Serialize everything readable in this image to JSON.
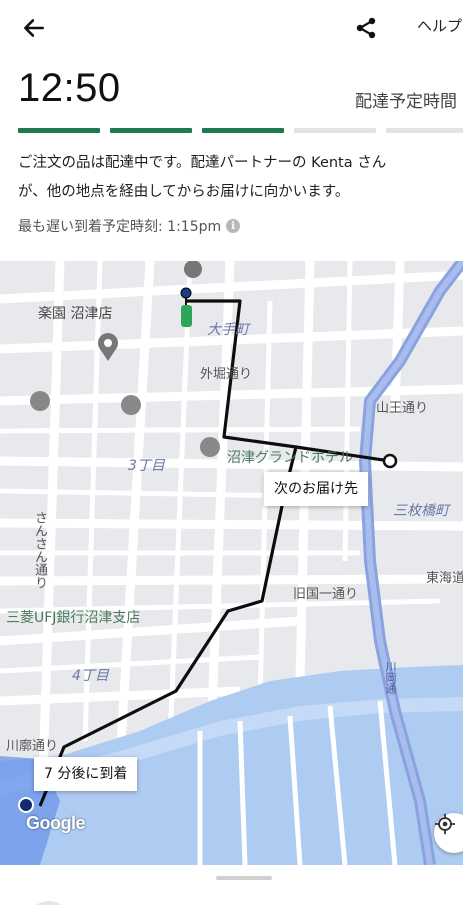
{
  "header": {
    "help_label": "ヘルプ",
    "back_icon": "arrow-left-icon",
    "share_icon": "share-icon"
  },
  "eta": {
    "time": "12:50",
    "label": "配達予定時間"
  },
  "progress": {
    "completed_segments": 3,
    "total_segments": 5,
    "active_color": "#1e7b4f",
    "inactive_color": "#e3e3e3"
  },
  "status": {
    "line1": "ご注文の品は配達中です。配達パートナーの Kenta さん",
    "line2": "が、他の地点を経由してからお届けに向かいます。",
    "latest_arrival": "最も遅い到着予定時刻: 1:15pm"
  },
  "map": {
    "labels": {
      "rakuen": "楽園 沼津店",
      "otemachi": "大手町",
      "sotobori": "外堀通り",
      "sannou": "山王通り",
      "chome3": "3丁目",
      "grand_hotel": "沼津グランドホテル",
      "sanmaibashi": "三枚橋町",
      "sansan": "さんさん通り",
      "tokaido": "東海道",
      "kyukokuichi": "旧国一通り",
      "mufg": "三菱UFJ銀行沼津支店",
      "chome4": "4丁目",
      "kawaroku": "川廓通り",
      "river_road": "川岡通"
    },
    "next_delivery": "次のお届け先",
    "arrival": "7 分後に到着",
    "google": "Google",
    "colors": {
      "route": "#0d0d0d",
      "water": "#a8c8f5",
      "highway": "#8aa3e0",
      "courier": "#2ea65a"
    }
  }
}
